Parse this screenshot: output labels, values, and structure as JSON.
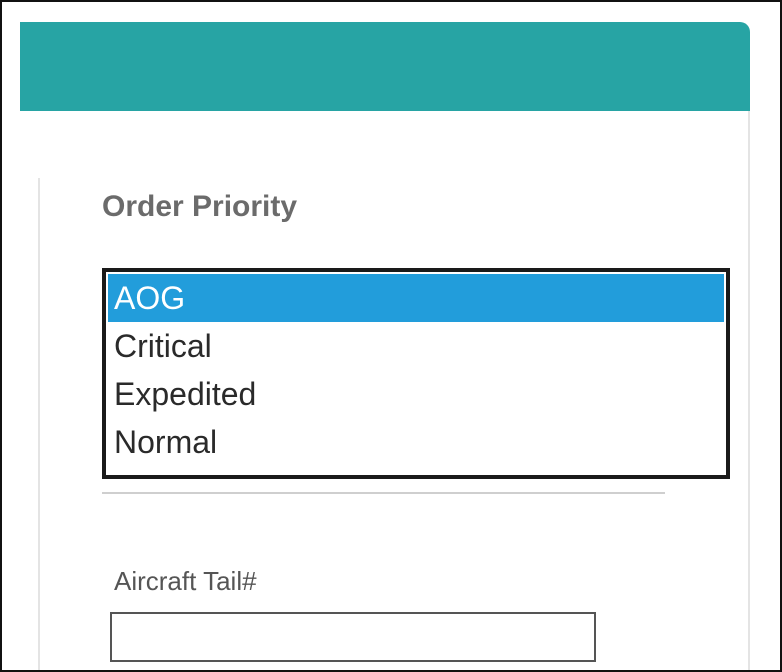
{
  "order_priority": {
    "title": "Order Priority",
    "selected": "AOG",
    "options": [
      {
        "label": "AOG",
        "selected": true
      },
      {
        "label": "Critical",
        "selected": false
      },
      {
        "label": "Expedited",
        "selected": false
      },
      {
        "label": "Normal",
        "selected": false
      }
    ]
  },
  "aircraft_tail": {
    "label": "Aircraft Tail#",
    "value": "",
    "placeholder": ""
  },
  "colors": {
    "header": "#27a4a4",
    "selection": "#229ddb",
    "label_text": "#6b6b6b"
  }
}
